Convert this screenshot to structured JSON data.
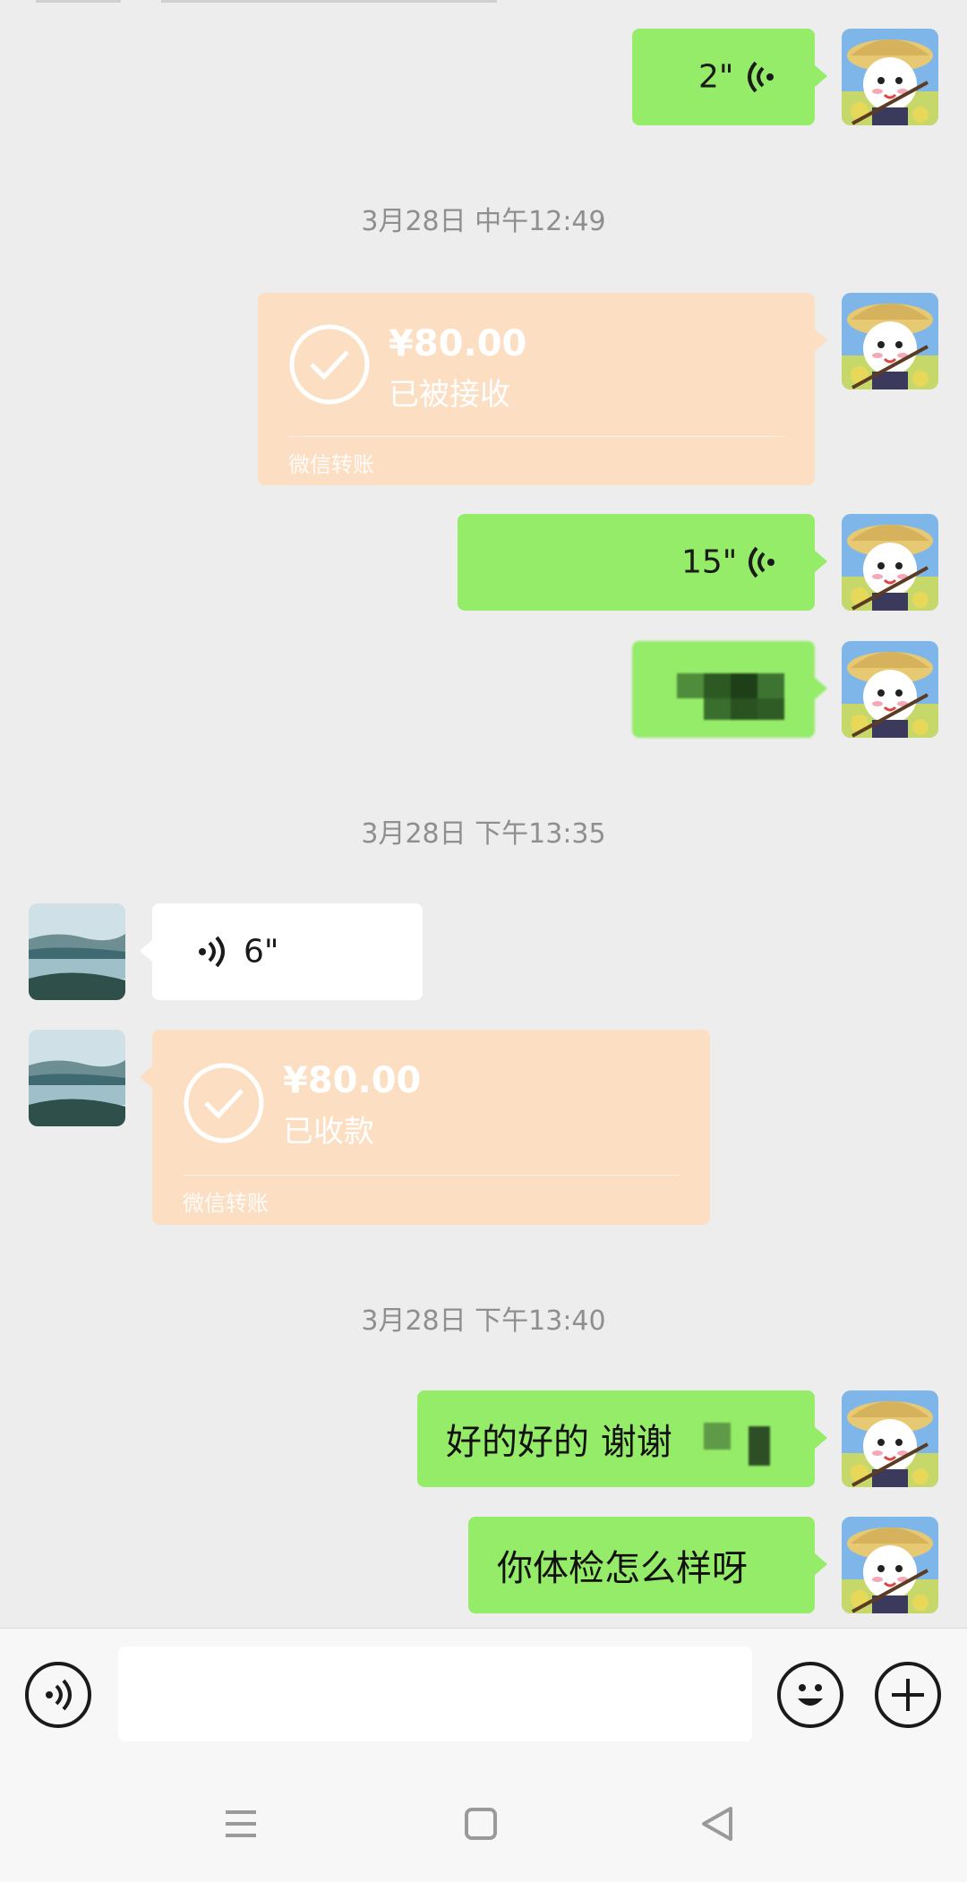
{
  "timestamps": {
    "t1": "3月28日 中午12:49",
    "t2": "3月28日 下午13:35",
    "t3": "3月28日 下午13:40"
  },
  "messages": {
    "voice1": "2\"",
    "transfer1": {
      "amount": "¥80.00",
      "status": "已被接收",
      "label": "微信转账"
    },
    "voice2": "15\"",
    "voice3": "6\"",
    "transfer2": {
      "amount": "¥80.00",
      "status": "已收款",
      "label": "微信转账"
    },
    "text1": "好的好的 谢谢",
    "text2": "你体检怎么样呀"
  },
  "input_bar": {
    "value": ""
  },
  "icons": {
    "voice": "voice-input-icon",
    "emoji": "emoji-icon",
    "plus": "plus-icon",
    "menu": "menu-icon",
    "home": "home-icon",
    "back": "back-icon"
  },
  "colors": {
    "background": "#ededed",
    "sent_bubble": "#95ec69",
    "received_bubble": "#ffffff",
    "transfer_bubble": "#fcdfc3",
    "timestamp": "#8f8f8f"
  }
}
